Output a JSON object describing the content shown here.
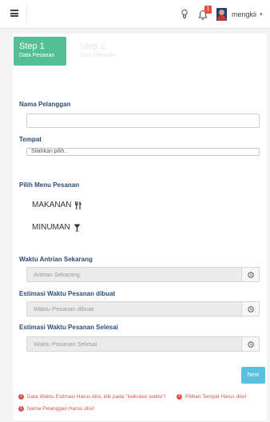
{
  "topbar": {
    "notification_count": "1",
    "user_name": "mengkii",
    "caret": "▾"
  },
  "steps": [
    {
      "title": "Step 1",
      "subtitle": "Data Pesanan"
    },
    {
      "title": "Step 2",
      "subtitle": "Data Pesanan"
    }
  ],
  "form": {
    "customer_label": "Nama Pelanggan",
    "customer_value": "",
    "place_label": "Tempat",
    "place_selected": "Silahkan pilih..",
    "menu_label": "Pilih Menu Pesanan",
    "menu_items": [
      {
        "label": "MAKANAN",
        "icon": "cutlery-icon"
      },
      {
        "label": "MINUMAN",
        "icon": "glass-icon"
      }
    ],
    "queue_label": "Waktu Antrian Sekarang",
    "queue_placeholder": "Antrian Sekarang",
    "est_made_label": "Estimasi Waktu Pesanan dibuat",
    "est_made_placeholder": "Waktu Pesanan dibuat",
    "est_done_label": "Estimasi Waktu Pesanan Selesai",
    "est_done_placeholder": "Waktu Pesanan Selesai",
    "next_label": "Next"
  },
  "errors": [
    "Data Waktu Estimasi Harus diisi, klik pada \"kalkulasi waktu\"!",
    "Pilihan Tempat Harus diisi!",
    "Nama Pelanggan Harus diisi!"
  ],
  "colors": {
    "step_active": "#55bf94",
    "label": "#2b4d74",
    "next_button": "#5bc0de",
    "error": "#d9534f",
    "badge": "#e84c3d"
  }
}
